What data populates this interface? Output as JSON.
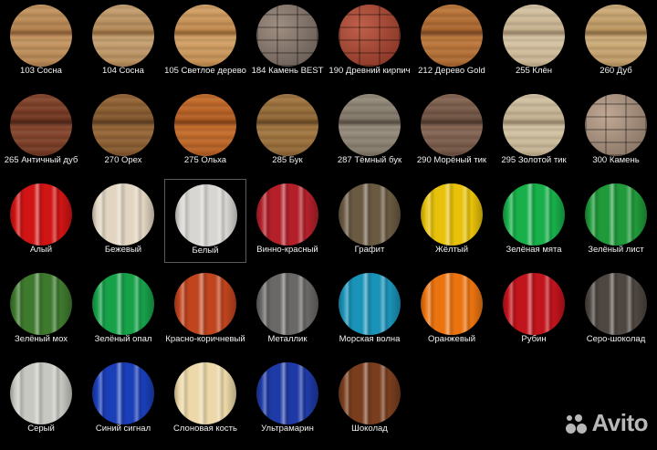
{
  "swatches": [
    {
      "label": "103 Сосна",
      "kind": "wood",
      "c1": "#c99a66",
      "c2": "#b0804d",
      "c3": "#8a5a30",
      "selected": false
    },
    {
      "label": "104 Сосна",
      "kind": "wood",
      "c1": "#c9a476",
      "c2": "#b28857",
      "c3": "#8e6538",
      "selected": false
    },
    {
      "label": "105 Светлое дерево",
      "kind": "wood",
      "c1": "#d6a56b",
      "c2": "#c08a4e",
      "c3": "#93622f",
      "selected": false
    },
    {
      "label": "184 Камень BEST",
      "kind": "stone",
      "c1": "#6e625a",
      "c2": "#a08f82",
      "c3": "#5a4e47",
      "selected": false
    },
    {
      "label": "190 Древний кирпич",
      "kind": "stone",
      "c1": "#8e3a2a",
      "c2": "#c0604a",
      "c3": "#6e2a1e",
      "selected": false
    },
    {
      "label": "212 Дерево Gold",
      "kind": "wood",
      "c1": "#c07c3f",
      "c2": "#a8652e",
      "c3": "#7a4520",
      "selected": false
    },
    {
      "label": "255 Клён",
      "kind": "wood",
      "c1": "#d9c7a8",
      "c2": "#c5b08e",
      "c3": "#9a8466",
      "selected": false
    },
    {
      "label": "260 Дуб",
      "kind": "wood",
      "c1": "#d0b07e",
      "c2": "#bb9661",
      "c3": "#8c6b40",
      "selected": false
    },
    {
      "label": "265 Античный дуб",
      "kind": "wood",
      "c1": "#8a4a30",
      "c2": "#6e3520",
      "c3": "#4a2214",
      "selected": false
    },
    {
      "label": "270 Орех",
      "kind": "wood",
      "c1": "#9a6a3a",
      "c2": "#80552c",
      "c3": "#5a3a1c",
      "selected": false
    },
    {
      "label": "275 Ольха",
      "kind": "wood",
      "c1": "#c8702e",
      "c2": "#b05c22",
      "c3": "#7e3e14",
      "selected": false
    },
    {
      "label": "285 Бук",
      "kind": "wood",
      "c1": "#a67a44",
      "c2": "#8e6535",
      "c3": "#634420",
      "selected": false
    },
    {
      "label": "287 Тёмный бук",
      "kind": "wood",
      "c1": "#9a9080",
      "c2": "#7e7466",
      "c3": "#54493e",
      "selected": false
    },
    {
      "label": "290 Морёный тик",
      "kind": "wood",
      "c1": "#8a6a58",
      "c2": "#6c5040",
      "c3": "#4a3428",
      "selected": false
    },
    {
      "label": "295 Золотой тик",
      "kind": "wood",
      "c1": "#d6c6a8",
      "c2": "#c0ae8e",
      "c3": "#968468",
      "selected": false
    },
    {
      "label": "300 Камень",
      "kind": "stone",
      "c1": "#8e7a6a",
      "c2": "#c0a894",
      "c3": "#6a584a",
      "selected": false
    },
    {
      "label": "Алый",
      "kind": "metal",
      "c1": "#d11414",
      "selected": false
    },
    {
      "label": "Бежевый",
      "kind": "metal",
      "c1": "#e2d6c2",
      "selected": false
    },
    {
      "label": "Белый",
      "kind": "metal",
      "c1": "#d8d6d2",
      "selected": true
    },
    {
      "label": "Винно-красный",
      "kind": "metal",
      "c1": "#b3202a",
      "selected": false
    },
    {
      "label": "Графит",
      "kind": "metal",
      "c1": "#6a5a42",
      "selected": false
    },
    {
      "label": "Жёлтый",
      "kind": "metal",
      "c1": "#e8c20a",
      "selected": false
    },
    {
      "label": "Зелёная мята",
      "kind": "metal",
      "c1": "#18b04a",
      "selected": false
    },
    {
      "label": "Зелёный лист",
      "kind": "metal",
      "c1": "#1f9a3a",
      "selected": false
    },
    {
      "label": "Зелёный мох",
      "kind": "metal",
      "c1": "#3e7a2e",
      "selected": false
    },
    {
      "label": "Зелёный опал",
      "kind": "metal",
      "c1": "#17a24a",
      "selected": false
    },
    {
      "label": "Красно-коричневый",
      "kind": "metal",
      "c1": "#c0441e",
      "selected": false
    },
    {
      "label": "Металлик",
      "kind": "metal",
      "c1": "#6a6866",
      "selected": false
    },
    {
      "label": "Морская волна",
      "kind": "metal",
      "c1": "#1a93b8",
      "selected": false
    },
    {
      "label": "Оранжевый",
      "kind": "metal",
      "c1": "#ec7410",
      "selected": false
    },
    {
      "label": "Рубин",
      "kind": "metal",
      "c1": "#c2141c",
      "selected": false
    },
    {
      "label": "Серо-шоколад",
      "kind": "metal",
      "c1": "#4e4640",
      "selected": false
    },
    {
      "label": "Серый",
      "kind": "metal",
      "c1": "#c8c8c2",
      "selected": false
    },
    {
      "label": "Синий сигнал",
      "kind": "metal",
      "c1": "#1a3fb8",
      "selected": false
    },
    {
      "label": "Слоновая кость",
      "kind": "metal",
      "c1": "#ecd8a8",
      "selected": false
    },
    {
      "label": "Ультрамарин",
      "kind": "metal",
      "c1": "#1e3aa6",
      "selected": false
    },
    {
      "label": "Шоколад",
      "kind": "metal",
      "c1": "#7a3e1e",
      "selected": false
    }
  ],
  "watermark": {
    "text": "Avito",
    "icon": "avito-logo-icon"
  }
}
